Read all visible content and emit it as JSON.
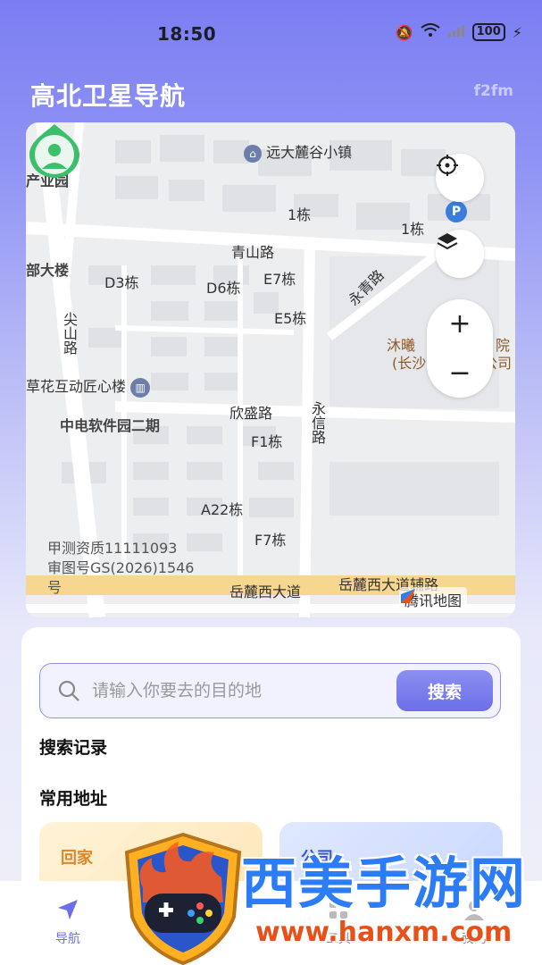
{
  "status_bar": {
    "time": "18:50",
    "battery": "100"
  },
  "header": {
    "title": "高北卫星导航",
    "corner_tag": "f2fm"
  },
  "map": {
    "labels": [
      {
        "text": "远大麓谷小镇",
        "bold": false
      },
      {
        "text": "产业园",
        "bold": true
      },
      {
        "text": "1栋"
      },
      {
        "text": "1栋"
      },
      {
        "text": "青山路"
      },
      {
        "text": "部大楼",
        "bold": true
      },
      {
        "text": "D3栋"
      },
      {
        "text": "D6栋"
      },
      {
        "text": "E7栋"
      },
      {
        "text": "永青路"
      },
      {
        "text": "E5栋"
      },
      {
        "text": "尖山路"
      },
      {
        "text": "沐曦"
      },
      {
        "text": "院"
      },
      {
        "text": "(长沙"
      },
      {
        "text": "公司"
      },
      {
        "text": "草花互动匠心楼",
        "bold": true
      },
      {
        "text": "欣盛路"
      },
      {
        "text": "永信路"
      },
      {
        "text": "中电软件园二期",
        "bold": true
      },
      {
        "text": "F1栋"
      },
      {
        "text": "A22栋"
      },
      {
        "text": "F7栋"
      },
      {
        "text": "岳麓西大道"
      },
      {
        "text": "岳麓西大道辅路"
      }
    ],
    "watermark": [
      "甲测资质11111093",
      "审图号GS(2026)1546",
      "号"
    ],
    "brand": "腾讯地图",
    "zoom_in": "+",
    "zoom_out": "−",
    "pin_label": "P"
  },
  "panel": {
    "search_placeholder": "请输入你要去的目的地",
    "search_button": "搜索",
    "history_title": "搜索记录",
    "address_title": "常用地址",
    "home_label": "回家",
    "company_label": "公司"
  },
  "tabbar": {
    "items": [
      {
        "label": "导航",
        "icon": "navigation-arrow-icon",
        "active": true
      },
      {
        "label": "工具",
        "icon": "tools-icon",
        "active": false
      },
      {
        "label": "我的",
        "icon": "profile-icon",
        "active": false
      }
    ]
  },
  "overlay": {
    "site_name": "西美手游网",
    "site_url": "www.hanxm.com"
  },
  "colors": {
    "accent": "#6c6fe8",
    "home_card": "#fff3d6",
    "company_card": "#dfe8ff"
  }
}
